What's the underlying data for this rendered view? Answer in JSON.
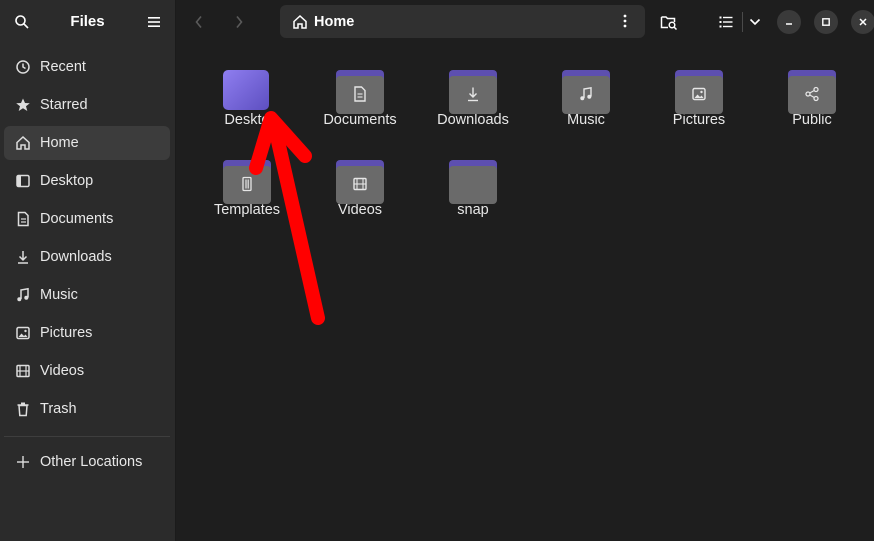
{
  "sidebar": {
    "title": "Files",
    "items": [
      {
        "label": "Recent",
        "icon": "clock-icon"
      },
      {
        "label": "Starred",
        "icon": "star-icon"
      },
      {
        "label": "Home",
        "icon": "home-icon",
        "active": true
      },
      {
        "label": "Desktop",
        "icon": "desktop-icon"
      },
      {
        "label": "Documents",
        "icon": "document-icon"
      },
      {
        "label": "Downloads",
        "icon": "download-icon"
      },
      {
        "label": "Music",
        "icon": "music-icon"
      },
      {
        "label": "Pictures",
        "icon": "picture-icon"
      },
      {
        "label": "Videos",
        "icon": "video-icon"
      },
      {
        "label": "Trash",
        "icon": "trash-icon"
      }
    ],
    "other_locations": "Other Locations"
  },
  "header": {
    "path_label": "Home"
  },
  "folders": [
    {
      "label": "Desktop",
      "visible_label": "Deskto",
      "emblem": "none"
    },
    {
      "label": "Documents",
      "emblem": "document-icon"
    },
    {
      "label": "Downloads",
      "emblem": "download-icon"
    },
    {
      "label": "Music",
      "emblem": "music-icon"
    },
    {
      "label": "Pictures",
      "emblem": "picture-icon"
    },
    {
      "label": "Public",
      "emblem": "share-icon"
    },
    {
      "label": "Templates",
      "emblem": "template-icon"
    },
    {
      "label": "Videos",
      "emblem": "video-icon"
    },
    {
      "label": "snap",
      "emblem": "none"
    }
  ],
  "colors": {
    "accent": "#5d4fb0",
    "annotation_arrow": "#ff0000"
  }
}
